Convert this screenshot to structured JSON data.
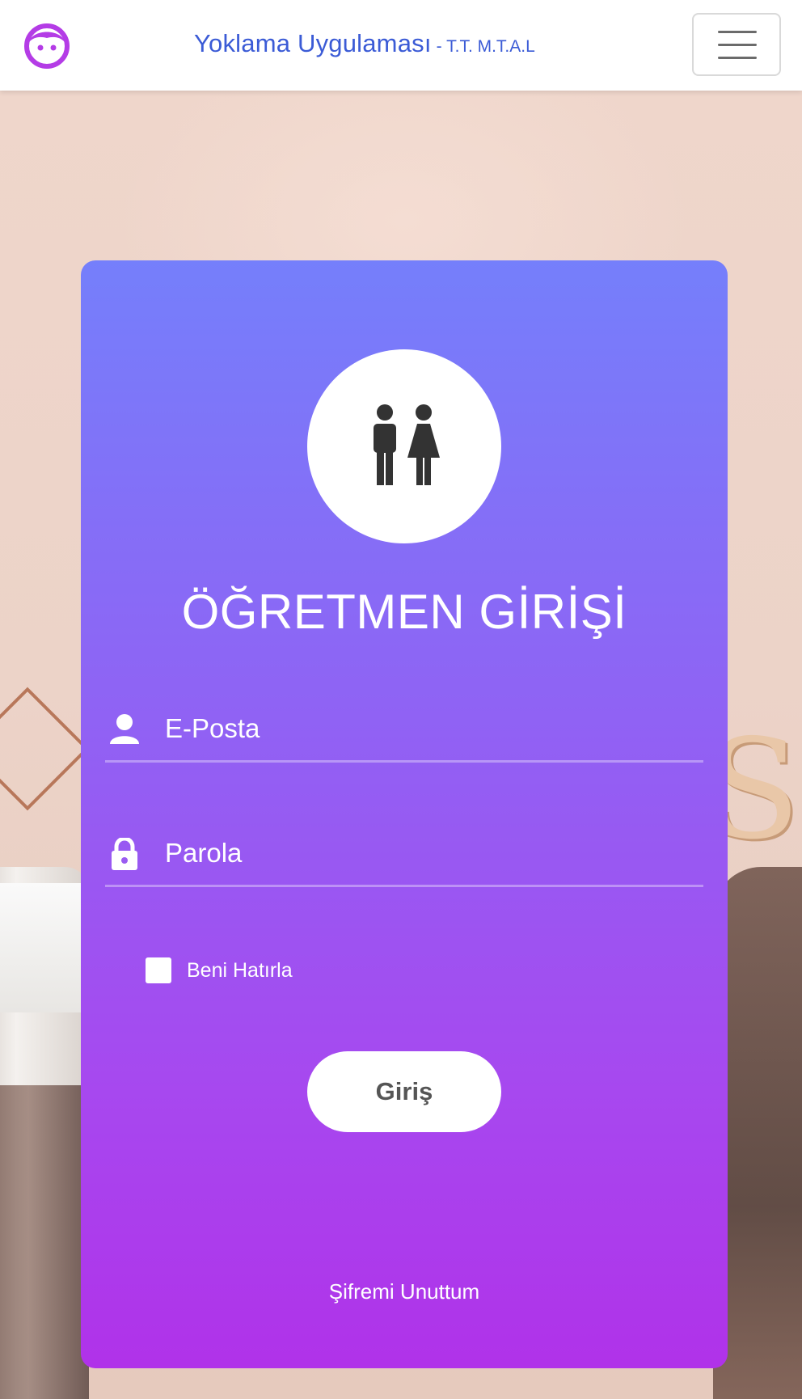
{
  "navbar": {
    "brand_title": "Yoklama Uygulaması",
    "brand_subtitle": "- T.T. M.T.A.L",
    "logo_icon": "face-icon",
    "menu_icon": "hamburger-icon"
  },
  "login": {
    "avatar_icon": "man-woman-icon",
    "title": "ÖĞRETMEN GİRİŞİ",
    "email_placeholder": "E-Posta",
    "email_value": "",
    "password_placeholder": "Parola",
    "password_value": "",
    "remember_label": "Beni Hatırla",
    "remember_checked": false,
    "submit_label": "Giriş",
    "forgot_label": "Şifremi Unuttum"
  },
  "colors": {
    "brand_text": "#3b5bd6",
    "logo": "#b43ce6",
    "card_gradient_top": "#757ffb",
    "card_gradient_bottom": "#b032e9"
  }
}
